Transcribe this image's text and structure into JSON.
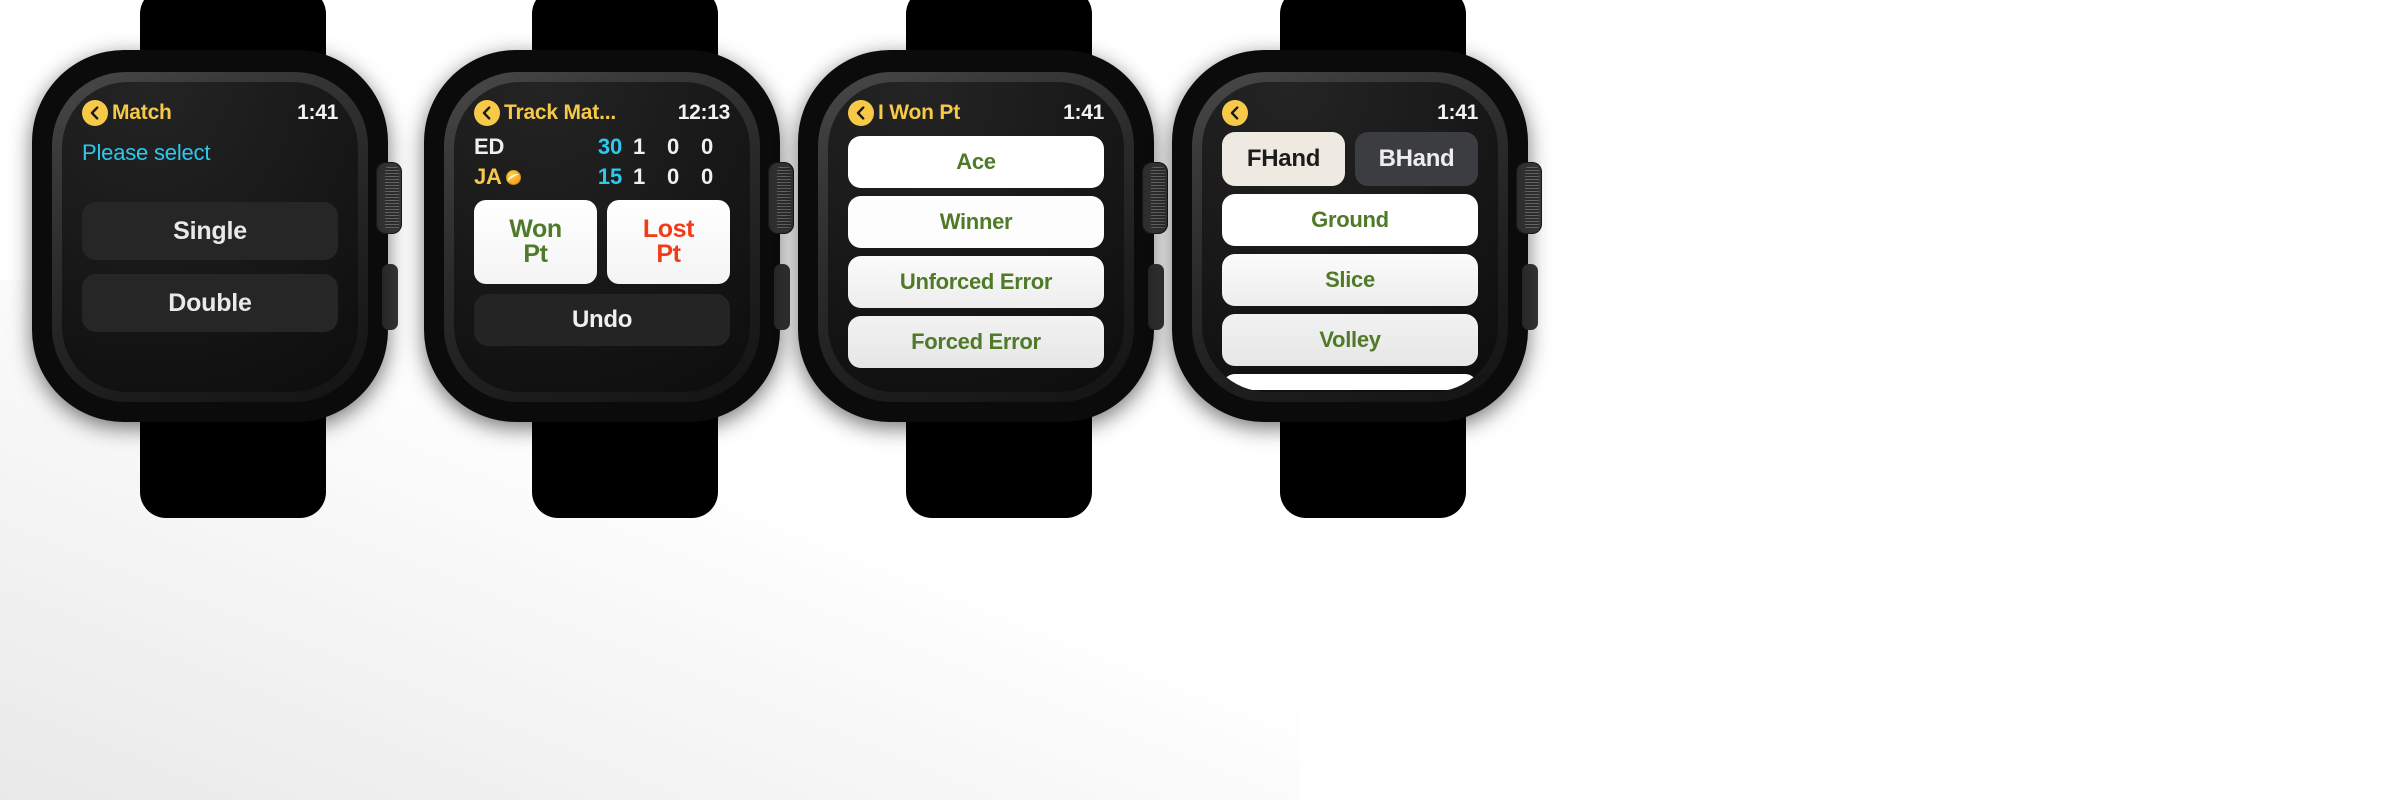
{
  "theme": {
    "accent_yellow": "#f7c948",
    "cyan": "#2ec8ef",
    "green": "#4f7a28",
    "red": "#f03c18",
    "screen_bg": "#0d0d0d",
    "page_bg": "#ffffff"
  },
  "watches": [
    {
      "id": "match-select",
      "header": {
        "back_icon": "chevron-left-icon",
        "title": "Match",
        "time": "1:41"
      },
      "prompt": "Please select",
      "buttons": [
        {
          "label": "Single"
        },
        {
          "label": "Double"
        }
      ]
    },
    {
      "id": "track-match",
      "header": {
        "back_icon": "chevron-left-icon",
        "title": "Track Mat...",
        "time": "12:13"
      },
      "scoreboard": {
        "columns": [
          "player",
          "points",
          "set1",
          "set2",
          "set3"
        ],
        "rows": [
          {
            "player": "ED",
            "serving": false,
            "points": "30",
            "sets": [
              "1",
              "0",
              "0"
            ]
          },
          {
            "player": "JA",
            "serving": true,
            "serve_icon": "tennis-ball-icon",
            "points": "15",
            "sets": [
              "1",
              "0",
              "0"
            ]
          }
        ]
      },
      "actions": [
        {
          "label_line1": "Won",
          "label_line2": "Pt",
          "kind": "won"
        },
        {
          "label_line1": "Lost",
          "label_line2": "Pt",
          "kind": "lost"
        }
      ],
      "undo_label": "Undo"
    },
    {
      "id": "i-won-pt",
      "header": {
        "back_icon": "chevron-left-icon",
        "title": "I Won Pt",
        "time": "1:41"
      },
      "options": [
        {
          "label": "Ace"
        },
        {
          "label": "Winner"
        },
        {
          "label": "Unforced Error"
        },
        {
          "label": "Forced Error"
        }
      ]
    },
    {
      "id": "shot-type",
      "header": {
        "back_icon": "chevron-left-icon",
        "title": "",
        "time": "1:41"
      },
      "segmented": [
        {
          "label": "FHand",
          "selected": true
        },
        {
          "label": "BHand",
          "selected": false
        }
      ],
      "options": [
        {
          "label": "Ground"
        },
        {
          "label": "Slice"
        },
        {
          "label": "Volley"
        }
      ]
    }
  ]
}
